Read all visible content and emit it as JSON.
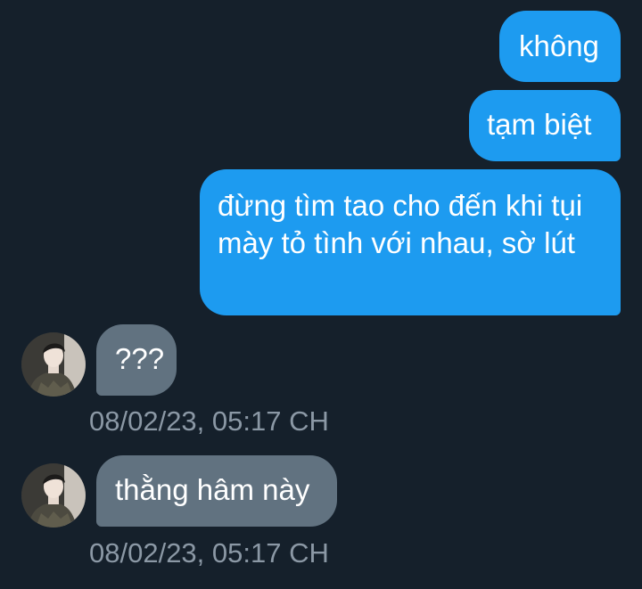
{
  "conversation": {
    "messages": [
      {
        "direction": "sent",
        "text": "không"
      },
      {
        "direction": "sent",
        "text": "tạm biệt"
      },
      {
        "direction": "sent",
        "text": "đừng tìm tao cho đến khi tụi mày tỏ tình với nhau, sờ lút"
      },
      {
        "direction": "received",
        "text": "???",
        "timestamp": "08/02/23, 05:17 CH",
        "avatar_icon": "user-avatar"
      },
      {
        "direction": "received",
        "text": "thằng hâm này",
        "timestamp": "08/02/23, 05:17 CH",
        "avatar_icon": "user-avatar"
      }
    ]
  },
  "colors": {
    "background": "#15202b",
    "sent_bubble": "#1d9bf0",
    "received_bubble": "#617280",
    "timestamp_text": "#8b98a5"
  }
}
